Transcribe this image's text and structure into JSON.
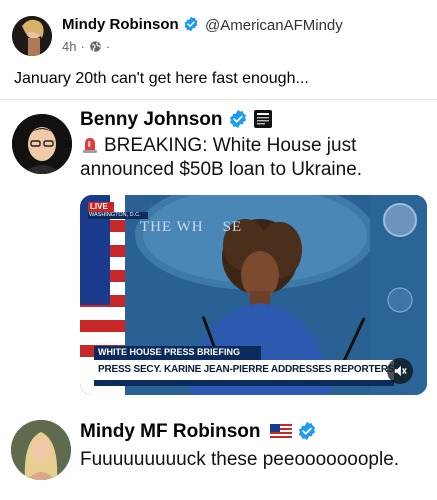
{
  "post": {
    "author": "Mindy Robinson",
    "handle": "@AmericanAFMindy",
    "time": "4h",
    "separator": "·",
    "text": "January 20th can't get here fast enough..."
  },
  "quote": {
    "author": "Benny Johnson",
    "text": "BREAKING: White House just announced $50B loan to Ukraine.",
    "video": {
      "live_label": "LIVE",
      "location": "WASHINGTON, D.C.",
      "backdrop_text": "THE WH    SE",
      "ticker_top": "WHITE HOUSE PRESS BRIEFING",
      "ticker_main": "PRESS SECY. KARINE JEAN-PIERRE ADDRESSES REPORTERS"
    }
  },
  "reply": {
    "author": "Mindy MF Robinson",
    "text": "Fuuuuuuuuuck these peeooooooople."
  },
  "colors": {
    "verified_blue": "#1d9bf0",
    "meta_gray": "#65676b",
    "text_dark": "#050505"
  },
  "icons": [
    "verified-badge-icon",
    "globe-icon",
    "siren-icon",
    "newspaper-badge-icon",
    "mute-icon",
    "us-flag-icon"
  ]
}
